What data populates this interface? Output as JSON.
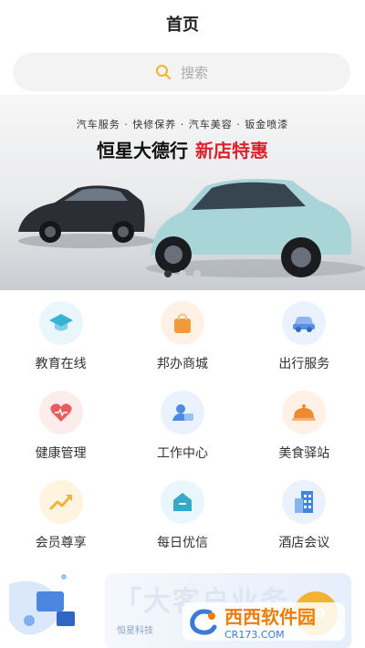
{
  "header": {
    "title": "首页"
  },
  "search": {
    "placeholder": "搜索"
  },
  "banner": {
    "tagline": "汽车服务 · 快修保养 · 汽车美容 · 钣金喷漆",
    "title_main": "恒星大德行",
    "title_highlight": "新店特惠",
    "pagination": {
      "count": 3,
      "active": 0
    }
  },
  "grid": {
    "items": [
      {
        "label": "教育在线",
        "icon": "graduation-cap-icon",
        "bg": "#e9f6fb",
        "fg": "#38b3d8"
      },
      {
        "label": "邦办商城",
        "icon": "shopping-bag-icon",
        "bg": "#fff1e6",
        "fg": "#f09a3a"
      },
      {
        "label": "出行服务",
        "icon": "car-icon",
        "bg": "#eaf2fd",
        "fg": "#5590e6"
      },
      {
        "label": "健康管理",
        "icon": "heart-icon",
        "bg": "#fdecec",
        "fg": "#ea5b5b"
      },
      {
        "label": "工作中心",
        "icon": "user-chat-icon",
        "bg": "#eaf2fd",
        "fg": "#4b8ae3"
      },
      {
        "label": "美食驿站",
        "icon": "food-cloche-icon",
        "bg": "#fff1e6",
        "fg": "#f08a2e"
      },
      {
        "label": "会员尊享",
        "icon": "trend-up-icon",
        "bg": "#fff4df",
        "fg": "#f2b335"
      },
      {
        "label": "每日优信",
        "icon": "home-icon",
        "bg": "#e9f6fb",
        "fg": "#36a8c9"
      },
      {
        "label": "酒店会议",
        "icon": "building-icon",
        "bg": "#eaf2fd",
        "fg": "#3f86de"
      }
    ]
  },
  "promo": {
    "title": "「大客户业务",
    "subtitle": "恒星科技",
    "cta": "GO"
  },
  "watermark": {
    "brand": "西西软件园",
    "url": "CR173.COM"
  }
}
